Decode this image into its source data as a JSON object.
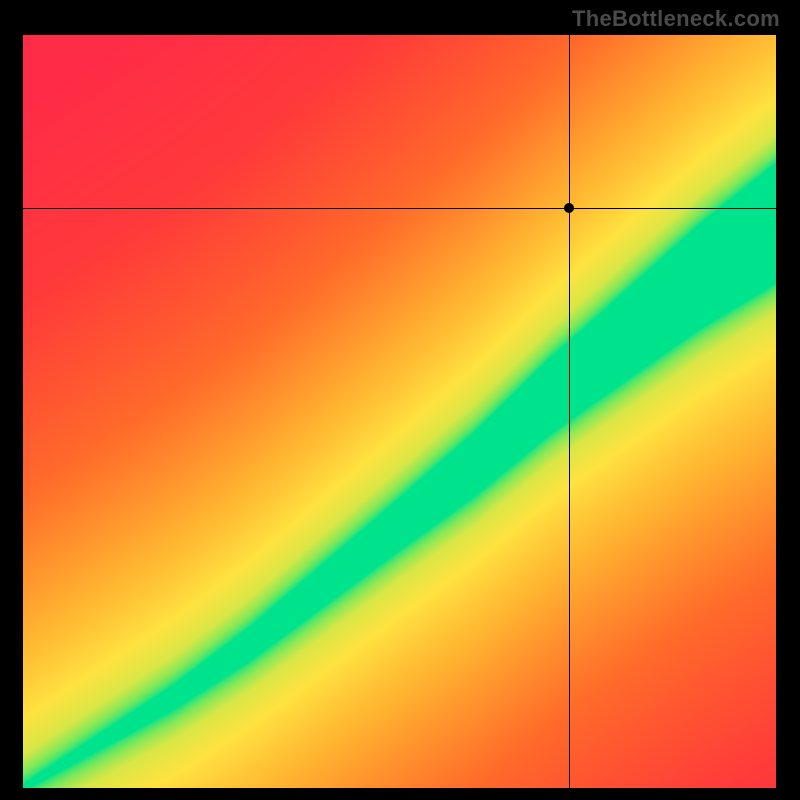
{
  "watermark": "TheBottleneck.com",
  "chart_data": {
    "type": "heatmap",
    "title": "",
    "xlabel": "",
    "ylabel": "",
    "xlim": [
      0,
      1
    ],
    "ylim": [
      0,
      1
    ],
    "crosshair": {
      "x": 0.725,
      "y": 0.77
    },
    "marker": {
      "x": 0.725,
      "y": 0.77
    },
    "ridge": {
      "description": "Optimal diagonal band (green) running lower-left to upper-right; away from it color grades through yellow/orange to red.",
      "points": [
        {
          "x": 0.0,
          "y": 0.0
        },
        {
          "x": 0.1,
          "y": 0.06
        },
        {
          "x": 0.2,
          "y": 0.12
        },
        {
          "x": 0.3,
          "y": 0.19
        },
        {
          "x": 0.4,
          "y": 0.27
        },
        {
          "x": 0.5,
          "y": 0.35
        },
        {
          "x": 0.6,
          "y": 0.43
        },
        {
          "x": 0.7,
          "y": 0.52
        },
        {
          "x": 0.8,
          "y": 0.6
        },
        {
          "x": 0.9,
          "y": 0.68
        },
        {
          "x": 1.0,
          "y": 0.75
        }
      ],
      "band_halfwidth_at_x": [
        {
          "x": 0.0,
          "hw": 0.005
        },
        {
          "x": 0.25,
          "hw": 0.02
        },
        {
          "x": 0.5,
          "hw": 0.035
        },
        {
          "x": 0.75,
          "hw": 0.055
        },
        {
          "x": 1.0,
          "hw": 0.08
        }
      ]
    },
    "color_stops": [
      {
        "d": 0.0,
        "color": "#00e38d"
      },
      {
        "d": 0.07,
        "color": "#7de85a"
      },
      {
        "d": 0.13,
        "color": "#d8e746"
      },
      {
        "d": 0.22,
        "color": "#ffe240"
      },
      {
        "d": 0.38,
        "color": "#ffb030"
      },
      {
        "d": 0.58,
        "color": "#ff6a2a"
      },
      {
        "d": 0.8,
        "color": "#ff3a3a"
      },
      {
        "d": 1.0,
        "color": "#ff2c47"
      }
    ]
  }
}
